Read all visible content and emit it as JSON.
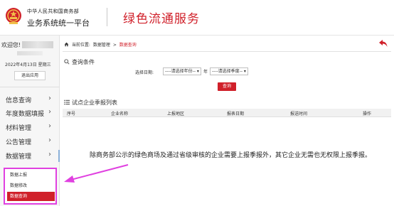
{
  "header": {
    "org": "中华人民共和国商务部",
    "platform": "业务系统统一平台",
    "service": "绿色流通服务",
    "brand_red": "#d0202a"
  },
  "sidebar": {
    "welcome": "欢迎您!",
    "date": "2022年4月13日 星期三",
    "logout": "退出应用",
    "items": [
      {
        "label": "信息查询"
      },
      {
        "label": "年度数据填报"
      },
      {
        "label": "材料管理"
      },
      {
        "label": "公告管理"
      },
      {
        "label": "数据管理"
      }
    ],
    "submenu": [
      {
        "label": "数据上报"
      },
      {
        "label": "数据修改"
      },
      {
        "label": "数据查询"
      }
    ]
  },
  "breadcrumb": {
    "prefix": "当前位置:",
    "level1": "数据管理",
    "sep": ">",
    "current": "数据查询"
  },
  "query": {
    "title": "查询条件",
    "date_label": "选择日期:",
    "year_select": "----请选择年份-- ▾",
    "year_unit": "年",
    "season_select": "----请选择季度-- ▾",
    "button": "查询"
  },
  "list": {
    "title": "试点企业季报列表",
    "columns": [
      "序号",
      "企业名称",
      "上报地区",
      "报表日期",
      "报送时间",
      "操作"
    ]
  },
  "notice": "除商务部公示的绿色商场及通过省级审核的企业需要上报季报外，其它企业无需也无权限上报季报。"
}
